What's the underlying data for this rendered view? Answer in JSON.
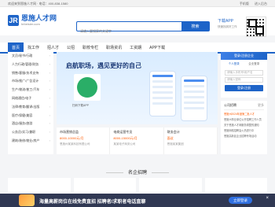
{
  "topbar": {
    "welcome": "欢迎来到恩施人才网 · 电话：400-838-1580",
    "links": [
      "手机版",
      "进入后台"
    ]
  },
  "header": {
    "logo_mark": "JR",
    "logo_name": "恩施人才网",
    "logo_url": "hrbeisier.com",
    "search_placeholder": "请输入要搜索的关键字",
    "search_button": "搜索",
    "app_title": "下载APP",
    "app_subtitle": "快速找到好工作"
  },
  "nav": {
    "items": [
      "首页",
      "找工作",
      "招人才",
      "公招",
      "职校专栏",
      "职场资讯",
      "工资期",
      "APP下载"
    ]
  },
  "sidebar": {
    "items": [
      "文员/秘书/行政",
      "人力行政/管理/财务",
      "销售/客服/技术支持",
      "市场/推广/广告设计",
      "生产/物流/普工/汽车",
      "网络通信/电子",
      "法律/教育/翻译/出版",
      "医疗/保健/美容",
      "酒店/服务/旅游",
      "公务员/实习/兼职",
      "建筑/装修/物业/房产"
    ]
  },
  "banner": {
    "title": "启航职场，遇见更好的自己",
    "caption": "扫码下载APP",
    "accent": "#1e64c8"
  },
  "jobs": [
    {
      "name": "市场营销总监",
      "salary": "8000-10000元/月",
      "company": "恩施州某某科技有限公司"
    },
    {
      "name": "电商运营专员",
      "salary": "8000-15000元/月",
      "company": "某某电子商务公司"
    },
    {
      "name": "财务会计",
      "salary": "面议",
      "company": "恩施某某集团"
    }
  ],
  "login": {
    "header": "登录/注册企业",
    "tabs": [
      "个人登录",
      "企业登录"
    ],
    "username_placeholder": "请输入手机号/用户名",
    "password_placeholder": "请输入密码",
    "button": "登录/注册"
  },
  "notice": {
    "title": "公司招聘",
    "more": "更多",
    "items": [
      "恩施州2024年度第二批人才",
      "恩施州事业单位公开招聘工作人员",
      "关于恩施人才网服务调整的通知",
      "恩施网络招聘会火热进行中",
      "恩施高新区企业招聘专场活动"
    ]
  },
  "section": {
    "title": "名企招聘"
  },
  "bottom_bar": {
    "text": "海量高薪岗位在线免费直招 招聘者/求职者电话直聊",
    "button": "立即登录",
    "close": "×"
  }
}
